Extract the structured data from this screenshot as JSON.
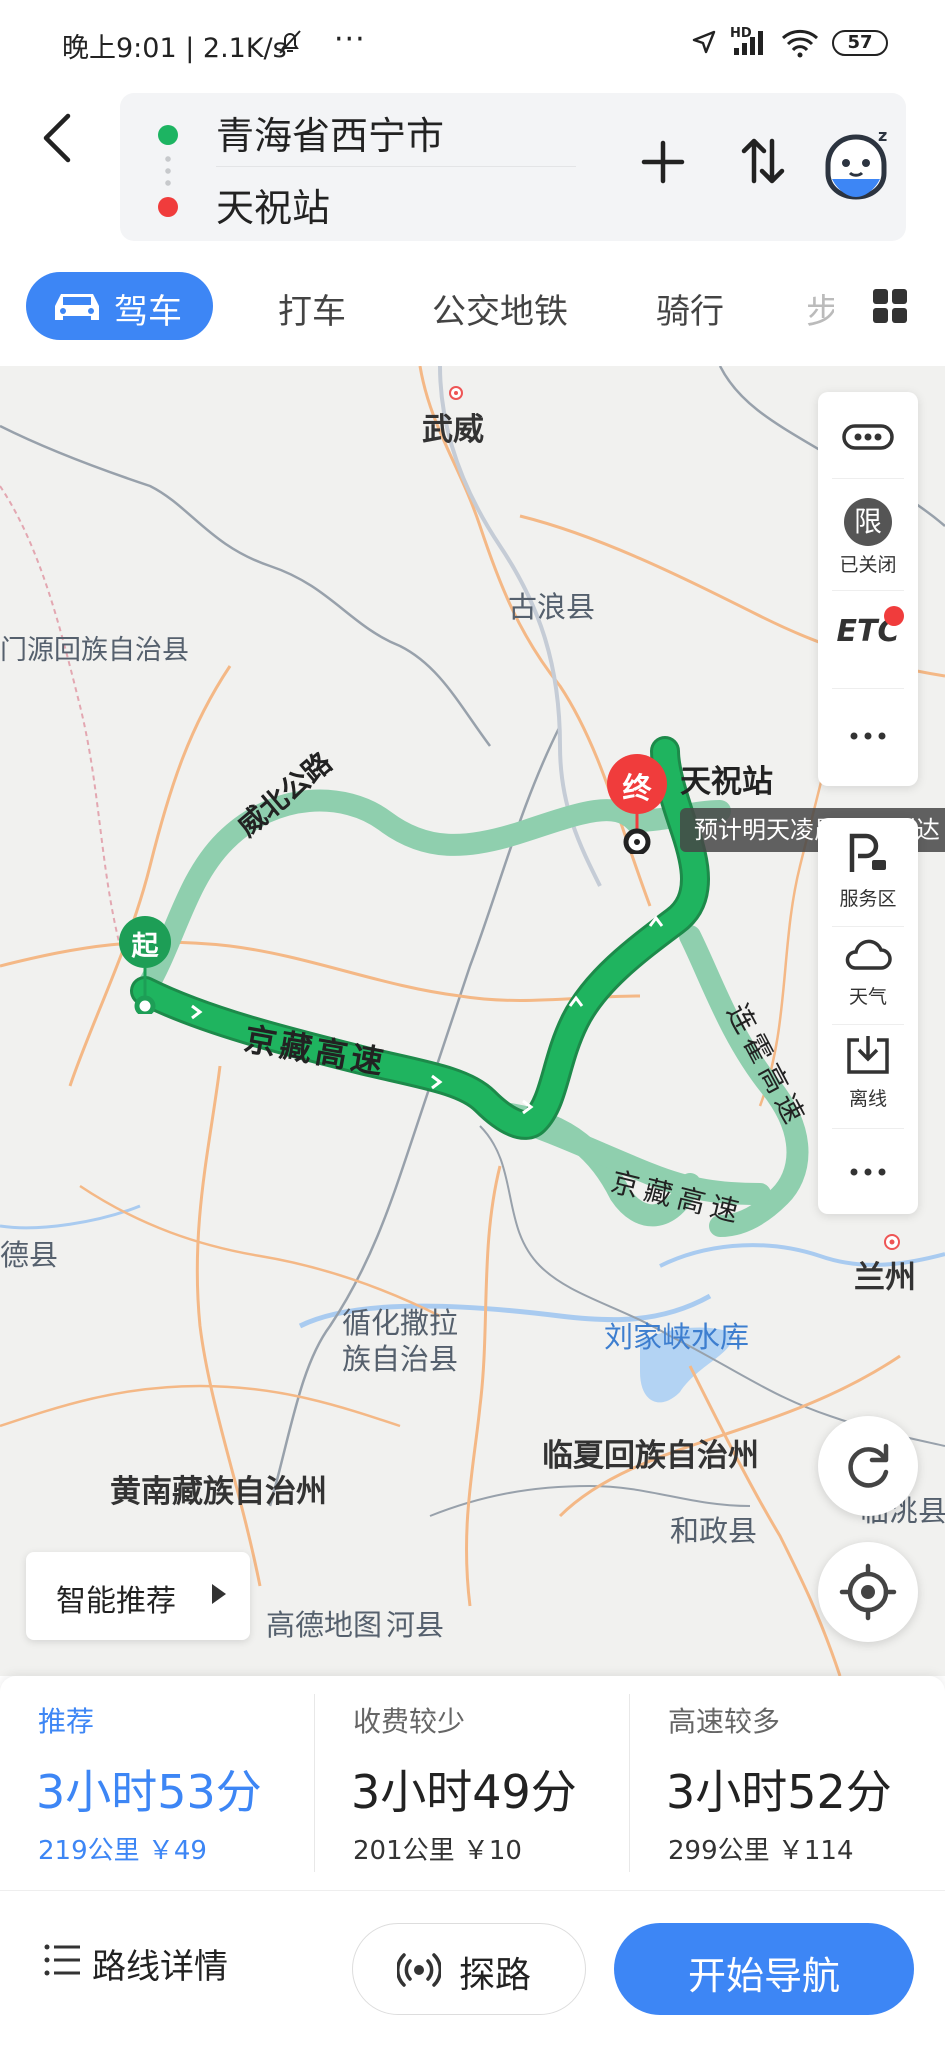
{
  "status_bar": {
    "time": "晚上9:01 | 2.1K/s",
    "more": "···",
    "hd": "HD",
    "battery": "57"
  },
  "header": {
    "from": "青海省西宁市",
    "to": "天祝站"
  },
  "modes": {
    "drive": "驾车",
    "taxi": "打车",
    "transit": "公交地铁",
    "ride": "骑行",
    "walk": "步"
  },
  "map": {
    "labels": [
      "武威",
      "古浪县",
      "门源回族自治县",
      "兰州",
      "德县",
      "循化撒拉",
      "族自治县",
      "刘家峡水库",
      "临夏回族自治州",
      "黄南藏族自治州",
      "和政县",
      "临洮县",
      "高德地图",
      "河县"
    ],
    "roads": {
      "weibei": "威北公路",
      "jingzang": "京藏高速",
      "jingzang2": "京藏高速",
      "lianhuo": "连霍高速"
    },
    "start_pin": "起",
    "end_pin": "终",
    "end_name": "天祝站",
    "eta_tip": "预计明天凌晨1:00到达",
    "route_colors": {
      "selected": "#1fb45f",
      "alternate": "#8fcfae"
    }
  },
  "side_panel": {
    "limit": "限",
    "limit_label": "已关闭",
    "etc": "ETC",
    "service_label": "服务区",
    "weather_label": "天气",
    "offline_label": "离线"
  },
  "smart_recommend": "智能推荐",
  "routes": [
    {
      "tag": "推荐",
      "duration": "3小时53分",
      "meta": "219公里  ￥49"
    },
    {
      "tag": "收费较少",
      "duration": "3小时49分",
      "meta": "201公里  ￥10"
    },
    {
      "tag": "高速较多",
      "duration": "3小时52分",
      "meta": "299公里  ￥114"
    }
  ],
  "bottom": {
    "details": "路线详情",
    "probe": "探路",
    "start": "开始导航"
  }
}
